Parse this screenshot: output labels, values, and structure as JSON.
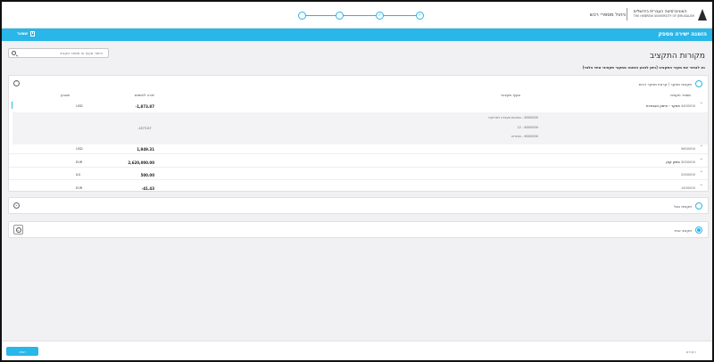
{
  "header": {
    "logo_hebrew": "האוניברסיטה העברית בירושלים",
    "logo_english": "THE HEBREW UNIVERSITY OF JERUSALEM",
    "app_title": "ניהול מספרי רכש",
    "steps": [
      "✓",
      "✓",
      "",
      ""
    ]
  },
  "toolbar": {
    "save_label": "שמור",
    "page_title": "הזמנה ישירה מספק"
  },
  "search": {
    "placeholder": "איתור סעיף או מספר תקציב"
  },
  "section": {
    "heading": "מקורות התקציב",
    "instructions": "נא לבחור את מקור התקציב (ניתן לבצע הזמנה ממקור תקציבי אחד בלבד)"
  },
  "sources": {
    "research": {
      "label": "תקציבי מחקר / קרנות מחקר רבות",
      "selected": false
    },
    "budget": {
      "label": "תקציבי סגל",
      "selected": false
    },
    "other": {
      "label": "תקציב אחר",
      "selected": true
    }
  },
  "table": {
    "columns": {
      "budget_number": "מספר תקציבי",
      "section": "סעיף תקציבי",
      "balance": "יתרה לשימוש",
      "currency": "מטבע"
    },
    "rows": [
      {
        "code": "4400000",
        "name": "מחקר - מימון בעבודות",
        "amount": "-1,873.87",
        "currency": "USD"
      },
      {
        "code": "5600000",
        "name": "",
        "amount": "1,949.31",
        "currency": "USD"
      },
      {
        "code": "3000000",
        "name": "משק קטן",
        "amount": "2,620,000.00",
        "currency": "EUR"
      },
      {
        "code": "2000000",
        "name": "",
        "amount": "500.00",
        "currency": "ILS"
      },
      {
        "code": "1400000",
        "name": "",
        "amount": "-41.43",
        "currency": "EUR"
      }
    ],
    "expanded_lines": [
      "6000000 - הוצאות מעבדה לפרויקט",
      "6000000 - 12",
      "6000000 - חומרים"
    ],
    "expanded_amount": "-1873.87"
  },
  "footer": {
    "next_label": "הבא",
    "prev_label": "הקודם"
  },
  "colors": {
    "accent": "#29b6e8"
  }
}
